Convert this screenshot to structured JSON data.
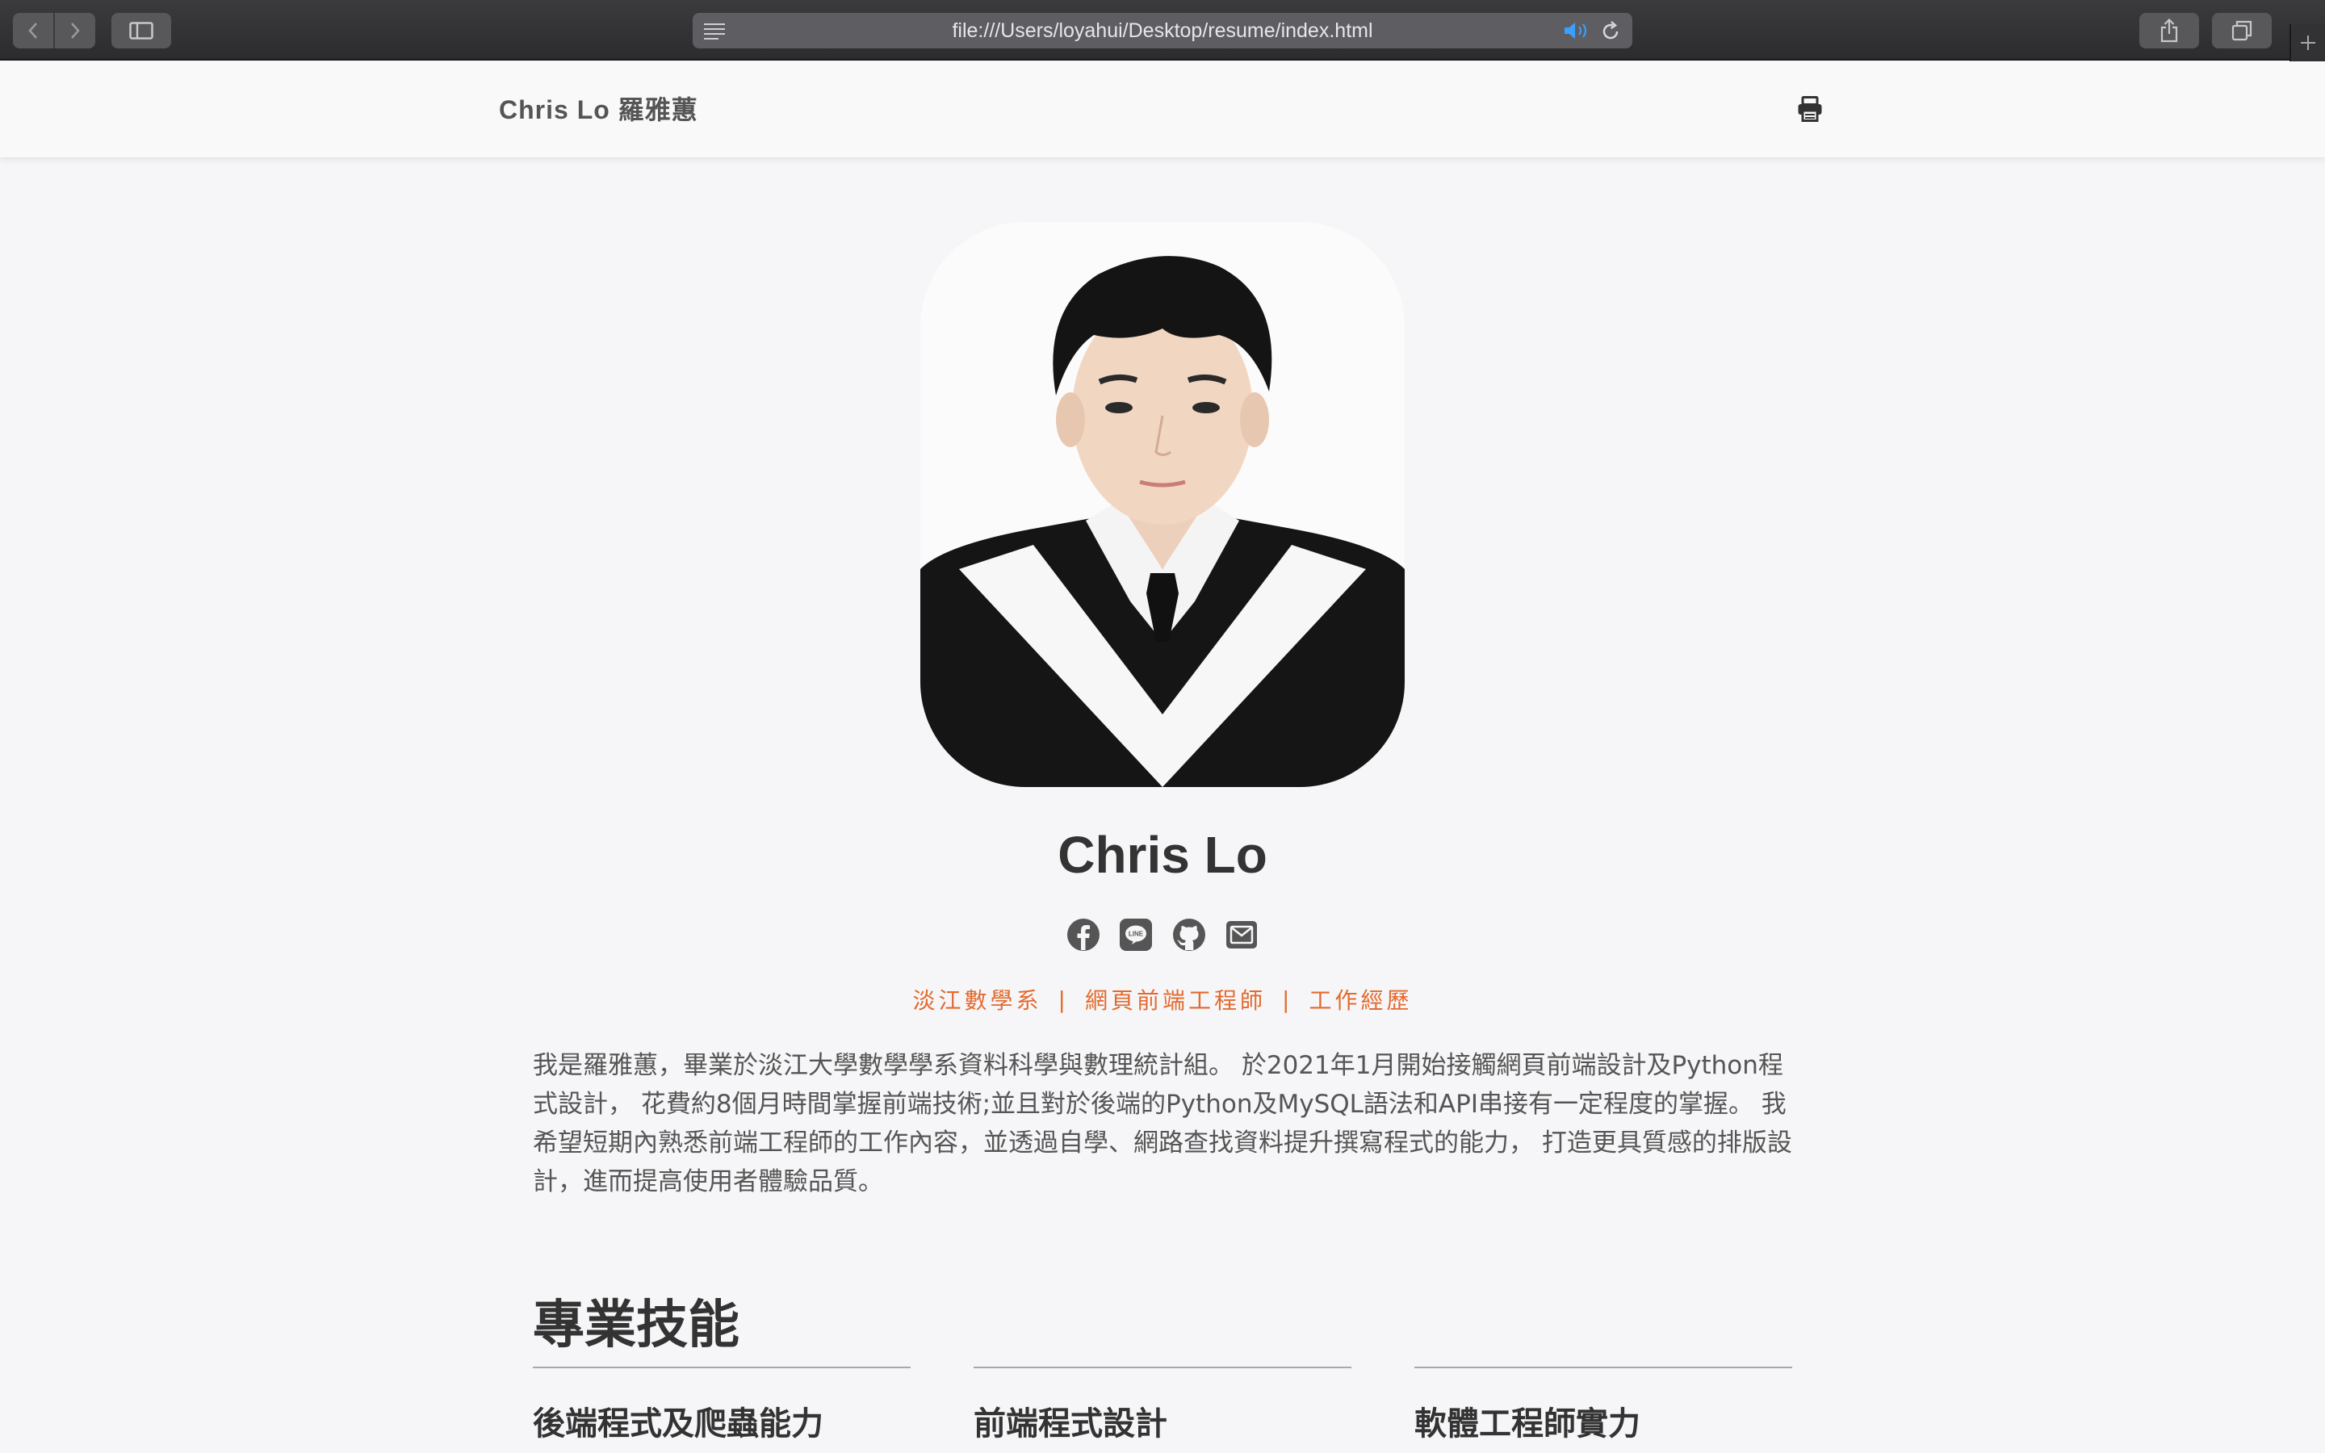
{
  "browser": {
    "url": "file:///Users/loyahui/Desktop/resume/index.html"
  },
  "header": {
    "brand": "Chris Lo 羅雅蕙",
    "print_icon": "print-icon"
  },
  "profile": {
    "name": "Chris Lo",
    "photo_alt": "graduation portrait",
    "socials": [
      "facebook-icon",
      "line-icon",
      "github-icon",
      "email-icon"
    ],
    "tags": [
      "淡江數學系",
      "網頁前端工程師",
      "工作經歷"
    ],
    "tag_separator": "|",
    "bio": "我是羅雅蕙，畢業於淡江大學數學學系資料科學與數理統計組。 於2021年1月開始接觸網頁前端設計及Python程式設計， 花費約8個月時間掌握前端技術;並且對於後端的Python及MySQL語法和API串接有一定程度的掌握。 我希望短期內熟悉前端工程師的工作內容，並透過自學、網路查找資料提升撰寫程式的能力， 打造更具質感的排版設計，進而提高使用者體驗品質。"
  },
  "skills": {
    "title": "專業技能",
    "columns": [
      {
        "title": "後端程式及爬蟲能力"
      },
      {
        "title": "前端程式設計"
      },
      {
        "title": "軟體工程師實力"
      }
    ]
  },
  "colors": {
    "accent": "#e36a2e",
    "text": "#333333",
    "background": "#f6f6f8"
  }
}
